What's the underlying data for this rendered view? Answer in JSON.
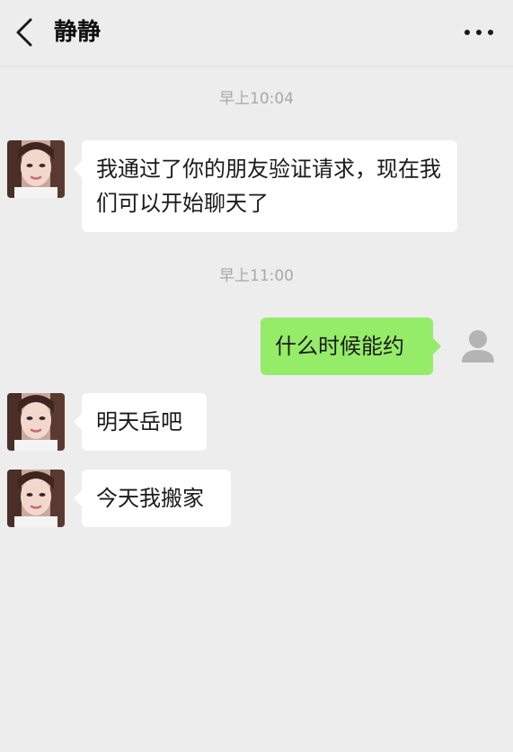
{
  "header": {
    "title": "静静",
    "back_icon": "chevron-left-icon",
    "more_icon": "more-horizontal-icon"
  },
  "messages": [
    {
      "type": "timestamp",
      "text": "早上10:04"
    },
    {
      "type": "incoming",
      "text": "我通过了你的朋友验证请求，现在我们可以开始聊天了"
    },
    {
      "type": "timestamp",
      "text": "早上11:00"
    },
    {
      "type": "outgoing",
      "text": "什么时候能约"
    },
    {
      "type": "incoming",
      "text": "明天岳吧"
    },
    {
      "type": "incoming",
      "text": "今天我搬家"
    }
  ],
  "colors": {
    "background": "#ededed",
    "incoming_bubble": "#ffffff",
    "outgoing_bubble": "#95ec69",
    "timestamp_text": "#a8a8a8"
  }
}
